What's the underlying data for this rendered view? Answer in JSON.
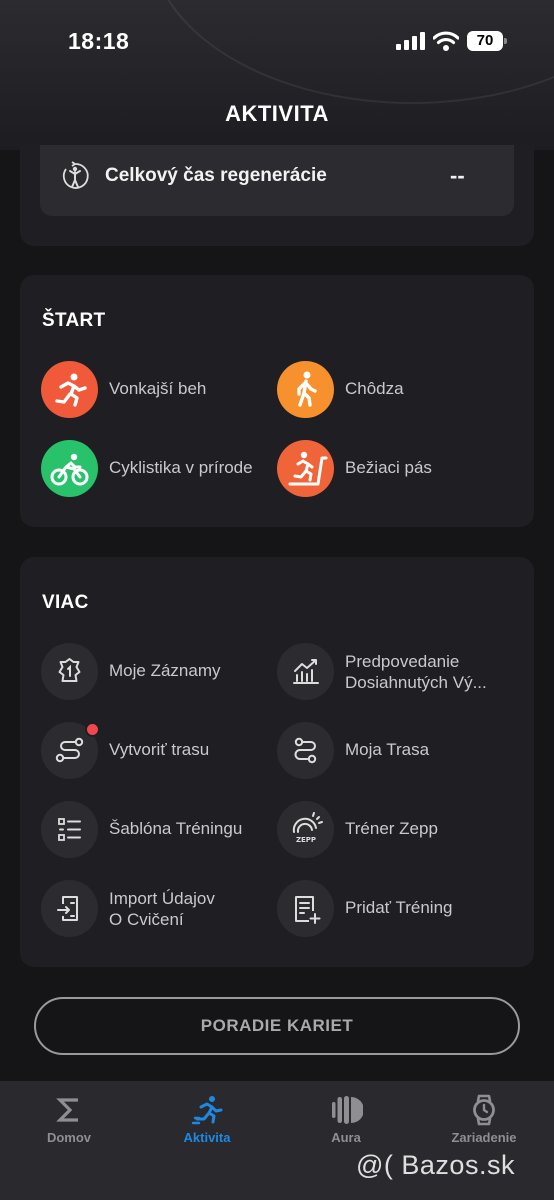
{
  "status_bar": {
    "time": "18:18",
    "battery": "70"
  },
  "header": {
    "title": "AKTIVITA"
  },
  "recovery": {
    "label": "Celkový čas regenerácie",
    "value": "--"
  },
  "start": {
    "title": "ŠTART",
    "items": [
      {
        "label": "Vonkajší beh",
        "icon": "running-icon",
        "color": "#f05a3a"
      },
      {
        "label": "Chôdza",
        "icon": "walking-icon",
        "color": "#f7912e"
      },
      {
        "label": "Cyklistika v prírode",
        "icon": "cycling-icon",
        "color": "#27c26a"
      },
      {
        "label": "Bežiaci pás",
        "icon": "treadmill-icon",
        "color": "#f0643a"
      }
    ]
  },
  "more": {
    "title": "VIAC",
    "items": [
      {
        "label": "Moje Záznamy",
        "icon": "records-icon"
      },
      {
        "label_line1": "Predpovedanie",
        "label_line2": "Dosiahnutých Vý...",
        "icon": "prediction-icon"
      },
      {
        "label": "Vytvoriť trasu",
        "icon": "create-route-icon",
        "has_badge": true
      },
      {
        "label": "Moja Trasa",
        "icon": "my-route-icon"
      },
      {
        "label": "Šablóna Tréningu",
        "icon": "template-icon"
      },
      {
        "label": "Tréner Zepp",
        "icon": "zepp-coach-icon",
        "icon_text": "ZEPP"
      },
      {
        "label_line1": "Import Údajov",
        "label_line2": "O Cvičení",
        "icon": "import-icon"
      },
      {
        "label": "Pridať Tréning",
        "icon": "add-training-icon"
      }
    ]
  },
  "reorder_button": {
    "label": "PORADIE KARIET"
  },
  "tabs": [
    {
      "label": "Domov",
      "icon": "sigma-icon",
      "active": false
    },
    {
      "label": "Aktivita",
      "icon": "activity-icon",
      "active": true
    },
    {
      "label": "Aura",
      "icon": "aura-icon",
      "active": false
    },
    {
      "label": "Zariadenie",
      "icon": "watch-icon",
      "active": false
    }
  ],
  "watermark": "@( Bazos.sk"
}
